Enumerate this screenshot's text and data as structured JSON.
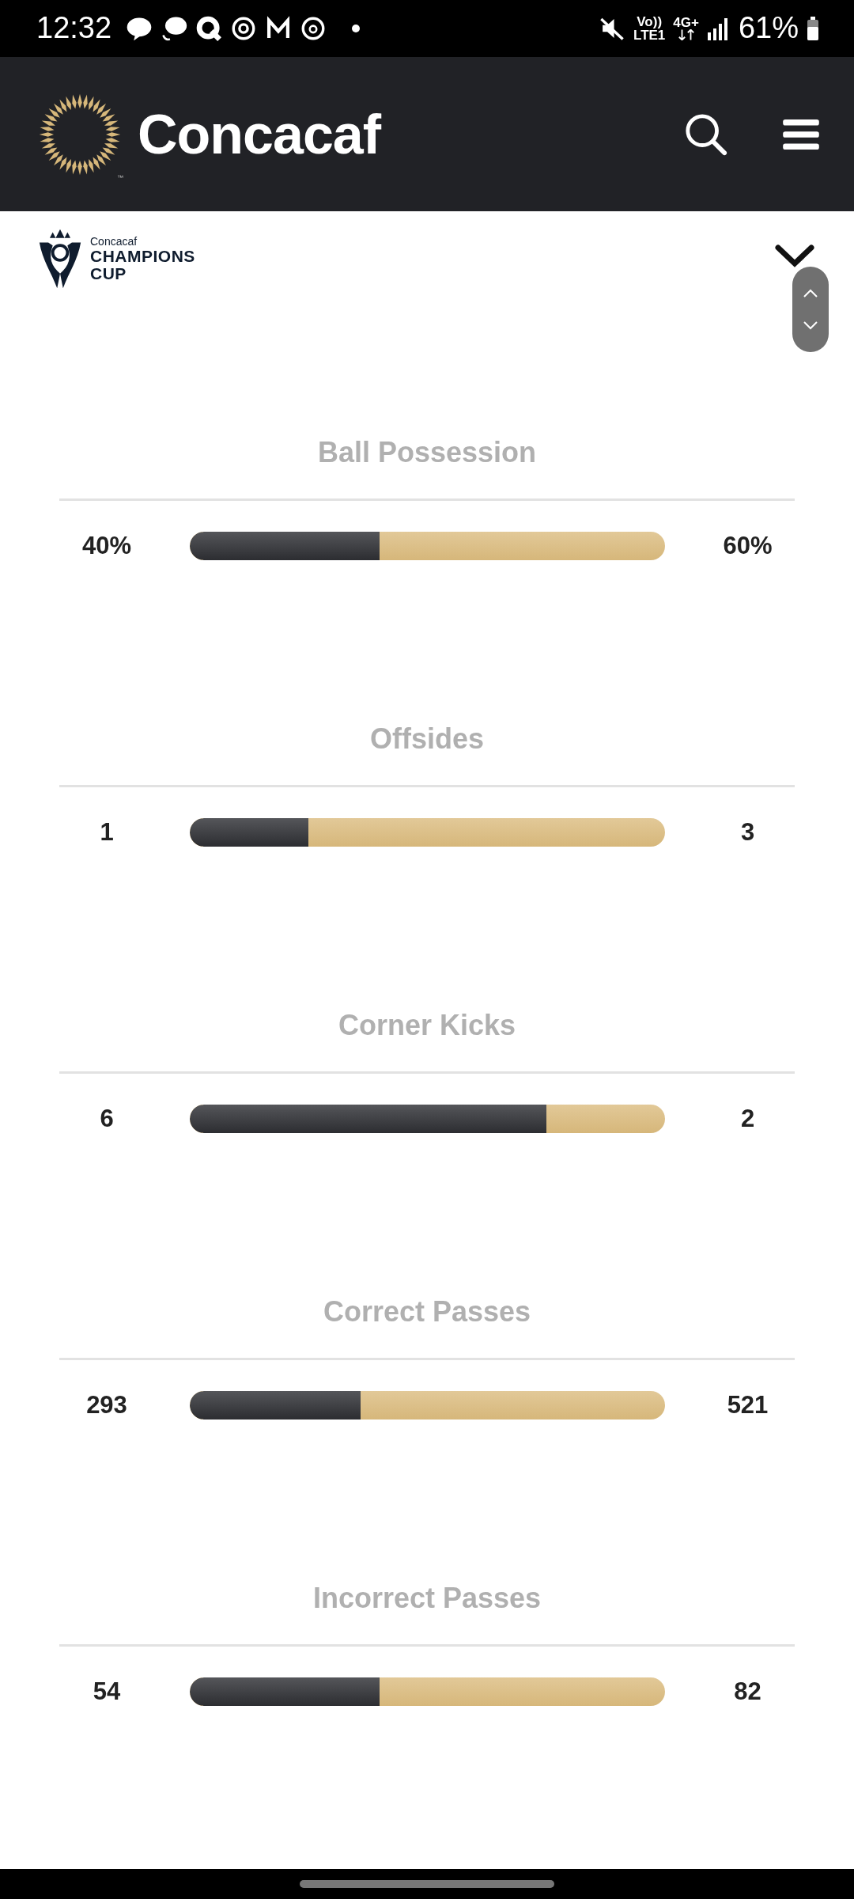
{
  "status_bar": {
    "time": "12:32",
    "volte": "Vo))",
    "lte": "LTE1",
    "network": "4G+",
    "battery": "61%"
  },
  "header": {
    "brand": "Concacaf",
    "trademark": "™"
  },
  "competition": {
    "line_1": "Concacaf",
    "line_2": "CHAMPIONS",
    "line_3": "CUP"
  },
  "stats": [
    {
      "title": "Ball Possession",
      "home": "40%",
      "away": "60%",
      "level": 0.4
    },
    {
      "title": "Offsides",
      "home": "1",
      "away": "3",
      "level": 0.25
    },
    {
      "title": "Corner Kicks",
      "home": "6",
      "away": "2",
      "level": 0.75
    },
    {
      "title": "Correct Passes",
      "home": "293",
      "away": "521",
      "level": 0.36
    },
    {
      "title": "Incorrect Passes",
      "home": "54",
      "away": "82",
      "level": 0.4
    }
  ]
}
